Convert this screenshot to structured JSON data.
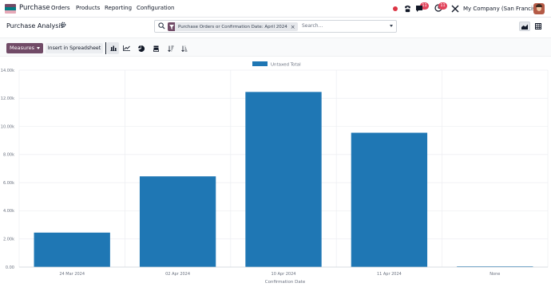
{
  "navbar": {
    "app_name": "Purchase",
    "menus": [
      "Orders",
      "Products",
      "Reporting",
      "Configuration"
    ],
    "chat_badge": "11",
    "activity_badge": "11",
    "company": "My Company (San Francisco)"
  },
  "control_panel": {
    "breadcrumb": "Purchase Analysis",
    "facet": "Purchase Orders or Confirmation Date: April 2024",
    "search_placeholder": "Search..."
  },
  "toolbar": {
    "measures_label": "Measures",
    "spreadsheet_label": "Insert in Spreadsheet"
  },
  "colors": {
    "brand": "#714b67",
    "bar": "#1f77b4"
  },
  "chart_data": {
    "type": "bar",
    "legend": "Untaxed Total",
    "legend_position": "top-center",
    "xlabel": "Confirmation Date",
    "ylabel": "",
    "categories": [
      "24 Mar 2024",
      "02 Apr 2024",
      "10 Apr 2024",
      "11 Apr 2024",
      "None"
    ],
    "values": [
      2450,
      6450,
      12450,
      9550,
      50
    ],
    "ylim": [
      0,
      14000
    ],
    "yticks": [
      0,
      2000,
      4000,
      6000,
      8000,
      10000,
      12000,
      14000
    ],
    "ytick_labels": [
      "0.00",
      "2.00k",
      "4.00k",
      "6.00k",
      "8.00k",
      "10.00k",
      "12.00k",
      "14.00k"
    ],
    "grid": true
  }
}
